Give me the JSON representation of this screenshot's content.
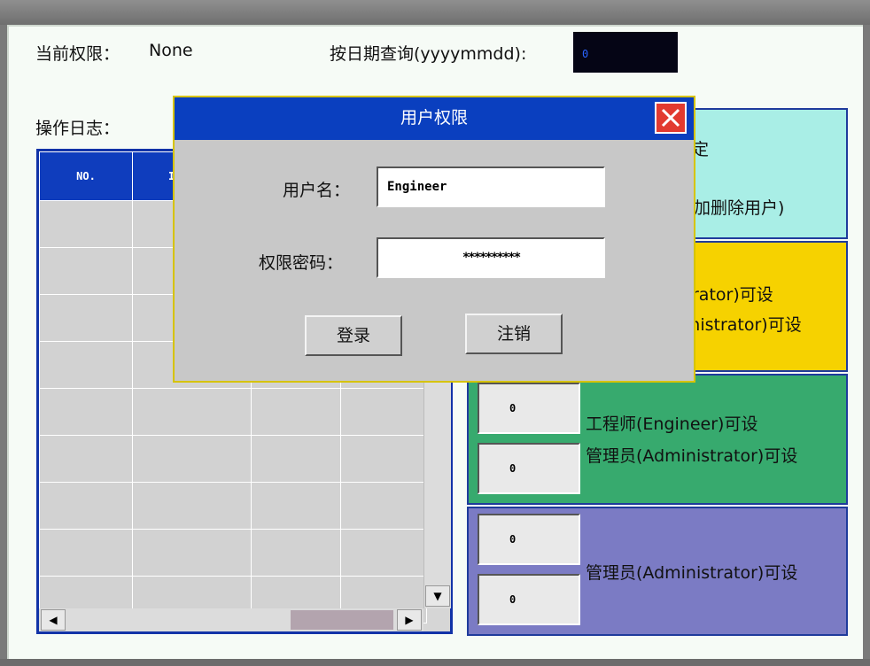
{
  "header": {
    "permission_label": "当前权限：",
    "permission_value": "None",
    "date_query_label": "按日期查询(yyyymmdd):",
    "date_query_value": "0"
  },
  "log": {
    "label": "操作日志：",
    "col_no": "NO.",
    "col_partial": "I",
    "row_count": 8
  },
  "panels": {
    "p1": {
      "line1": "定",
      "line2": "加删除用户)"
    },
    "p2": {
      "line1": "rator)可设",
      "line2": "inistrator)可设"
    },
    "p3": {
      "value1": "0",
      "value2": "0",
      "line1": "工程师(Engineer)可设",
      "line2": "管理员(Administrator)可设"
    },
    "p4": {
      "value1": "0",
      "value2": "0",
      "line1": "管理员(Administrator)可设"
    }
  },
  "dialog": {
    "title": "用户权限",
    "username_label": "用户名：",
    "username_value": "Engineer",
    "password_label": "权限密码：",
    "password_value": "**********",
    "login_button": "登录",
    "logout_button": "注销"
  },
  "colors": {
    "title_blue": "#0a3fbf",
    "close_red": "#e23a30",
    "panel_cyan": "#a9eee6",
    "panel_yellow": "#f6d200",
    "panel_green": "#37aa6e",
    "panel_purple": "#7b7bc4"
  }
}
